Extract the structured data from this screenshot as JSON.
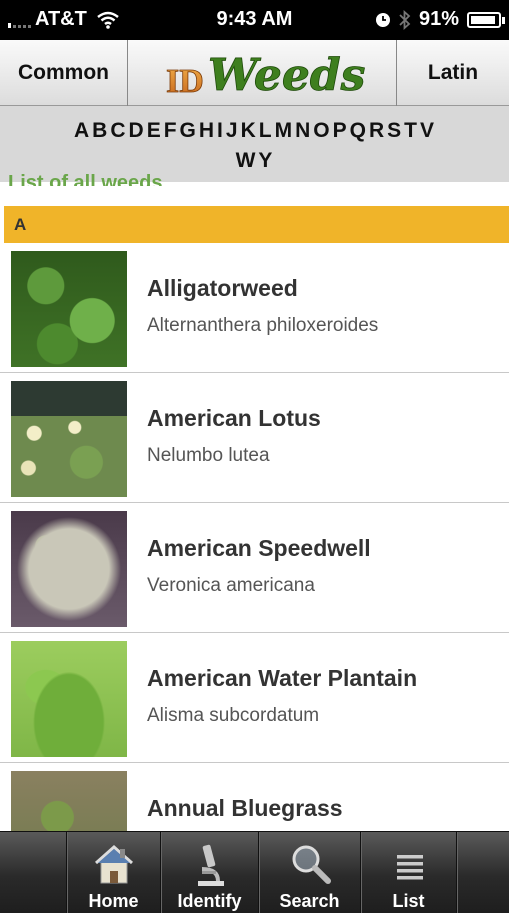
{
  "status_bar": {
    "carrier": "AT&T",
    "time": "9:43 AM",
    "battery": "91%",
    "battery_level": 0.91
  },
  "nav": {
    "left_label": "Common",
    "right_label": "Latin",
    "logo_prefix": "ID",
    "logo_text": "Weeds"
  },
  "alphabet": [
    "A",
    "B",
    "C",
    "D",
    "E",
    "F",
    "G",
    "H",
    "I",
    "J",
    "K",
    "L",
    "M",
    "N",
    "O",
    "P",
    "Q",
    "R",
    "S",
    "T",
    "V",
    "W",
    "Y"
  ],
  "list_title": "List of all weeds",
  "section": {
    "letter": "A"
  },
  "weeds": [
    {
      "common": "Alligatorweed",
      "latin": "Alternanthera philoxeroides"
    },
    {
      "common": "American Lotus",
      "latin": "Nelumbo lutea"
    },
    {
      "common": "American Speedwell",
      "latin": "Veronica americana"
    },
    {
      "common": "American Water Plantain",
      "latin": "Alisma subcordatum"
    },
    {
      "common": "Annual Bluegrass",
      "latin": ""
    }
  ],
  "tabs": [
    {
      "label": "Home",
      "icon": "home-icon"
    },
    {
      "label": "Identify",
      "icon": "microscope-icon"
    },
    {
      "label": "Search",
      "icon": "magnifier-icon"
    },
    {
      "label": "List",
      "icon": "list-icon"
    }
  ],
  "colors": {
    "section_header": "#f0b429",
    "logo_green": "#3e7f1e",
    "logo_orange": "#d47a1a"
  }
}
